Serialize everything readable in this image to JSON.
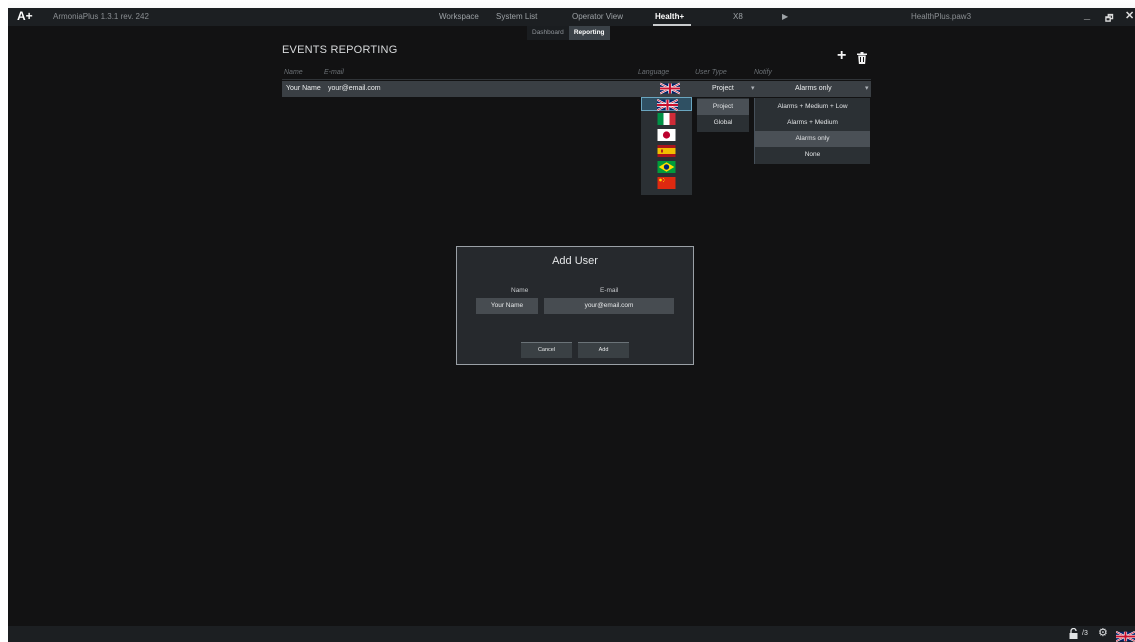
{
  "app": {
    "logo": "A+",
    "version": "ArmoniaPlus 1.3.1 rev. 242",
    "filename": "HealthPlus.paw3",
    "window_controls": [
      "_",
      "🗗",
      "✕"
    ]
  },
  "menu": {
    "items": [
      "Workspace",
      "System List",
      "Operator View",
      "Health+",
      "X8",
      "▶"
    ],
    "active": "Health+"
  },
  "subtabs": {
    "dashboard": "Dashboard",
    "reporting": "Reporting",
    "active": "Reporting"
  },
  "section": {
    "title": "EVENTS REPORTING",
    "add_icon": "plus-icon",
    "delete_icon": "trash-icon"
  },
  "table": {
    "headers": {
      "name": "Name",
      "email": "E-mail",
      "language": "Language",
      "user_type": "User Type",
      "notify": "Notify"
    },
    "rows": [
      {
        "name": "Your Name",
        "email": "your@email.com",
        "language": "uk-flag",
        "user_type": "Project",
        "notify": "Alarms only"
      }
    ]
  },
  "language_dropdown": {
    "options": [
      "uk-flag",
      "italy-flag",
      "japan-flag",
      "spain-flag",
      "brazil-flag",
      "china-flag"
    ],
    "selected": "uk-flag"
  },
  "user_type_dropdown": {
    "options": [
      "Project",
      "Global"
    ],
    "selected": "Project"
  },
  "notify_dropdown": {
    "options": [
      "Alarms + Medium + Low",
      "Alarms + Medium",
      "Alarms only",
      "None"
    ],
    "selected": "Alarms only"
  },
  "dialog": {
    "title": "Add User",
    "name_label": "Name",
    "email_label": "E-mail",
    "name_value": "Your Name",
    "email_value": "your@email.com",
    "cancel_label": "Cancel",
    "add_label": "Add"
  },
  "status": {
    "lock_icon": "lock-icon",
    "count": "/3",
    "settings_icon": "gear-icon",
    "language_icon": "uk-flag"
  },
  "colors": {
    "background": "#121213",
    "bar": "#1c1f22",
    "row": "#3a3f44",
    "selection": "#2f5063"
  }
}
